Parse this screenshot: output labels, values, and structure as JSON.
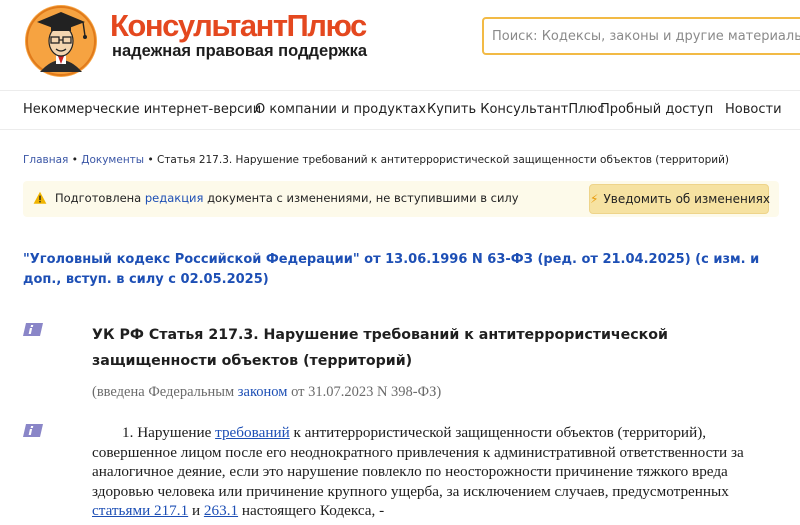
{
  "header": {
    "brand": "КонсультантПлюс",
    "tagline": "надежная правовая поддержка",
    "search_placeholder": "Поиск: Кодексы, законы и другие материалы"
  },
  "nav": {
    "items": [
      "Некоммерческие интернет-версии",
      "О компании и продуктах",
      "Купить КонсультантПлюс",
      "Пробный доступ",
      "Новости"
    ]
  },
  "breadcrumb": {
    "home": "Главная",
    "docs": "Документы",
    "sep": "•",
    "current": "Статья 217.3. Нарушение требований к антитеррористической защищенности объектов (территорий)"
  },
  "notice": {
    "text_before": "Подготовлена ",
    "link": "редакция",
    "text_after": " документа с изменениями, не вступившими в силу",
    "button": "Уведомить об изменениях"
  },
  "document": {
    "code_title": "\"Уголовный кодекс Российской Федерации\" от 13.06.1996 N 63-ФЗ (ред. от 21.04.2025) (с изм. и доп., вступ. в силу с 02.05.2025)",
    "article_title": "УК РФ Статья 217.3. Нарушение требований к антитеррористической защищенности объектов (территорий)",
    "introduced_before": "(введена Федеральным ",
    "introduced_link": "законом",
    "introduced_after": " от 31.07.2023 N 398-ФЗ)",
    "para_1": "1. Нарушение ",
    "para_link1": "требований",
    "para_2": " к антитеррористической защищенности объектов (территорий), совершенное лицом после его неоднократного привлечения к административной ответственности за аналогичное деяние, если это нарушение повлекло по неосторожности причинение тяжкого вреда здоровью человека или причинение крупного ущерба, за исключением случаев, предусмотренных ",
    "para_link2": "статьями 217.1",
    "para_3": " и ",
    "para_link3": "263.1",
    "para_4": " настоящего Кодекса, -"
  },
  "colors": {
    "brand": "#e4481f",
    "link": "#1d4fb5",
    "search_border": "#f2ba45",
    "notice_bg": "#fdfaea",
    "button_bg": "#f6e2a1",
    "info_icon": "#8a86c8"
  },
  "icons": {
    "logo": "professor-logo",
    "warning": "warning-icon",
    "bolt": "lightning-icon",
    "info": "info-icon"
  }
}
